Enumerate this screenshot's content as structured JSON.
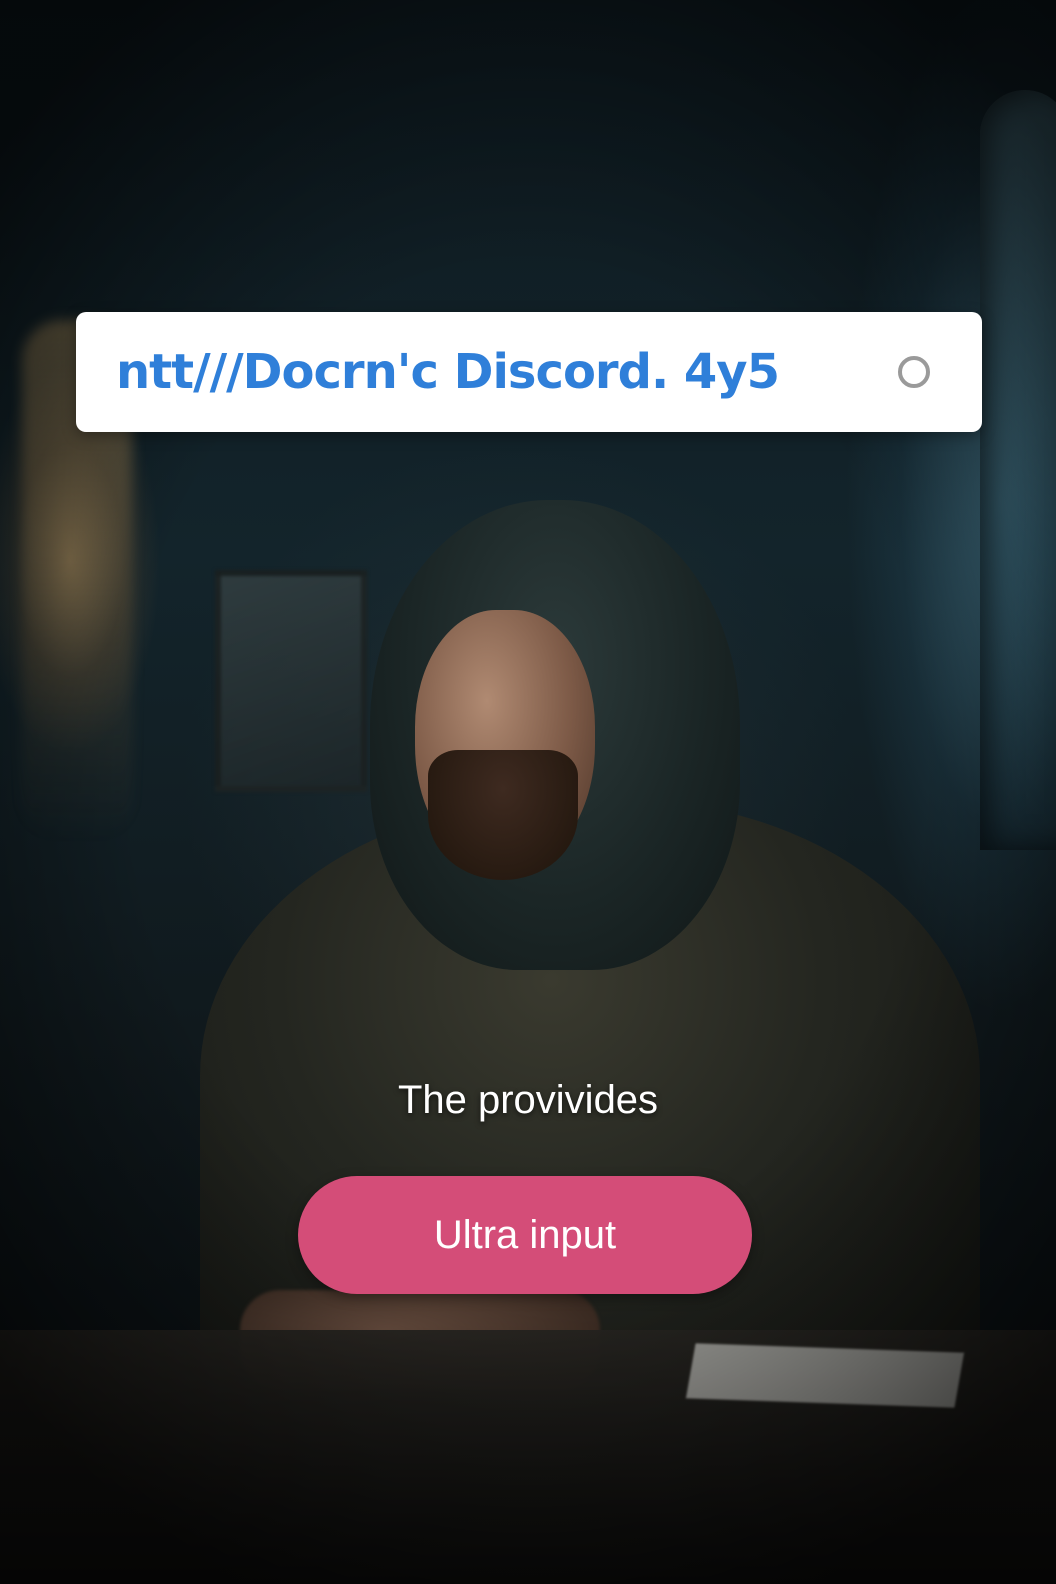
{
  "address_bar": {
    "url_text": "ntt///Docrn'c Discord. 4y5",
    "status_icon": "circle-icon"
  },
  "caption": {
    "text": "The provivides"
  },
  "cta": {
    "label": "Ultra input",
    "color": "#d44d78"
  },
  "colors": {
    "url_text": "#2f7fd9",
    "address_bar_bg": "#ffffff"
  }
}
